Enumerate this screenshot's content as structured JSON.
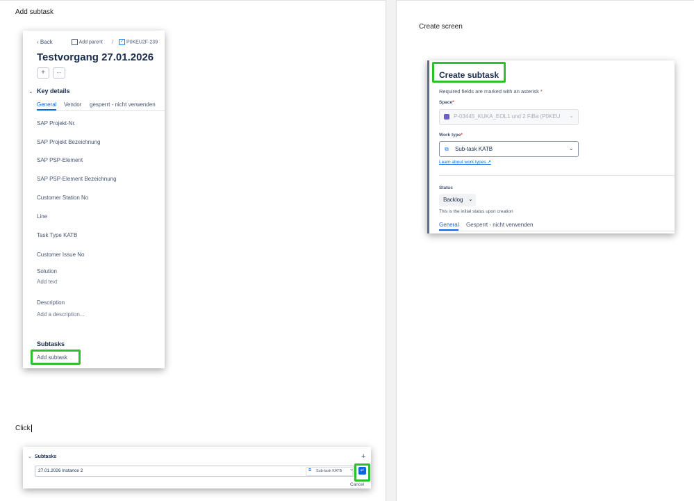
{
  "captions": {
    "add_subtask": "Add subtask",
    "create_screen": "Create screen",
    "click": "Click"
  },
  "issue_panel": {
    "back": "Back",
    "add_parent": "Add parent",
    "separator": "/",
    "issue_key": "P0KEU2F-239",
    "title": "Testvorgang 27.01.2026",
    "plus": "+",
    "more": "···",
    "key_details": "Key details",
    "tabs": [
      "General",
      "Vendor",
      "gesperrt - nicht verwenden"
    ],
    "fields": [
      "SAP Projekt-Nr.",
      "SAP Projekt Bezeichnung",
      "SAP PSP-Element",
      "SAP PSP-Element Bezeichnung",
      "Customer Station No",
      "Line",
      "Task Type KATB",
      "Customer Issue No"
    ],
    "solution_label": "Solution",
    "solution_placeholder": "Add text",
    "description_label": "Description",
    "description_placeholder": "Add a description...",
    "subtasks_label": "Subtasks",
    "add_subtask": "Add subtask"
  },
  "create_modal": {
    "title": "Create subtask",
    "required_note": "Required fields are marked with an asterisk",
    "asterisk": "*",
    "space_label": "Space",
    "space_value": "P-03445_KUKA_EOL1 und 2 FiBa (P0KEU",
    "work_type_label": "Work type",
    "work_type_value": "Sub-task KATB",
    "learn_link": "Learn about work types",
    "status_label": "Status",
    "status_value": "Backlog",
    "status_hint": "This is the initial status upon creation",
    "tabs": [
      "General",
      "Gesperrt - nicht verwenden"
    ]
  },
  "inline_create": {
    "subtasks_label": "Subtasks",
    "plus": "+",
    "input_value": "27.01.2026 Instance 2",
    "work_type": "Sub-task KATB",
    "enter": "↵",
    "cancel": "Cancel"
  },
  "colors": {
    "highlight": "#2cc02c",
    "accent": "#0c66e4",
    "text": "#172b4d",
    "subtle": "#44546f"
  }
}
